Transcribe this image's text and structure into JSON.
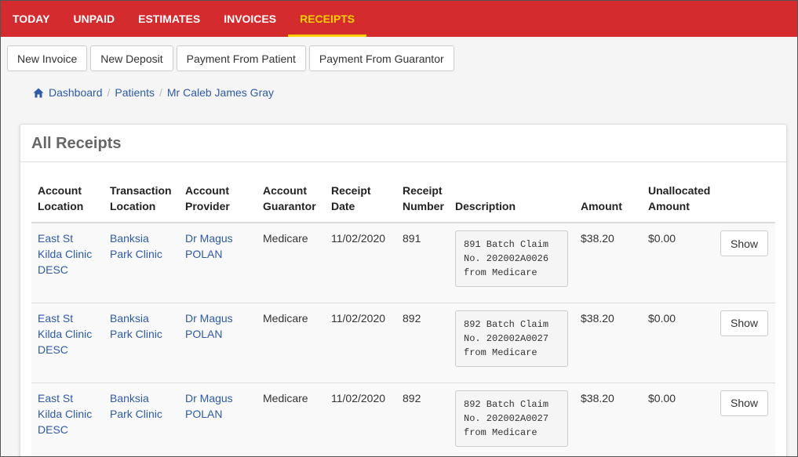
{
  "topnav": {
    "tabs": [
      {
        "label": "TODAY"
      },
      {
        "label": "UNPAID"
      },
      {
        "label": "ESTIMATES"
      },
      {
        "label": "INVOICES"
      },
      {
        "label": "RECEIPTS"
      }
    ],
    "active": "RECEIPTS"
  },
  "actions": {
    "new_invoice": "New Invoice",
    "new_deposit": "New Deposit",
    "payment_from_patient": "Payment From Patient",
    "payment_from_guarantor": "Payment From Guarantor"
  },
  "breadcrumb": {
    "dashboard": "Dashboard",
    "patients": "Patients",
    "patient_name": "Mr Caleb James Gray"
  },
  "panel": {
    "title": "All Receipts"
  },
  "table": {
    "headers": {
      "account_location": "Account Location",
      "transaction_location": "Transaction Location",
      "account_provider": "Account Provider",
      "account_guarantor": "Account Guarantor",
      "receipt_date": "Receipt Date",
      "receipt_number": "Receipt Number",
      "description": "Description",
      "amount": "Amount",
      "unallocated_amount": "Unallocated Amount"
    },
    "rows": [
      {
        "account_location": "East St Kilda Clinic DESC",
        "transaction_location": "Banksia Park Clinic",
        "account_provider": "Dr Magus POLAN",
        "account_guarantor": "Medicare",
        "receipt_date": "11/02/2020",
        "receipt_number": "891",
        "description": "891 Batch Claim\nNo. 202002A0026\nfrom Medicare",
        "amount": "$38.20",
        "unallocated_amount": "$0.00",
        "action": "Show"
      },
      {
        "account_location": "East St Kilda Clinic DESC",
        "transaction_location": "Banksia Park Clinic",
        "account_provider": "Dr Magus POLAN",
        "account_guarantor": "Medicare",
        "receipt_date": "11/02/2020",
        "receipt_number": "892",
        "description": "892 Batch Claim\nNo. 202002A0027\nfrom Medicare",
        "amount": "$38.20",
        "unallocated_amount": "$0.00",
        "action": "Show"
      },
      {
        "account_location": "East St Kilda Clinic DESC",
        "transaction_location": "Banksia Park Clinic",
        "account_provider": "Dr Magus POLAN",
        "account_guarantor": "Medicare",
        "receipt_date": "11/02/2020",
        "receipt_number": "892",
        "description": "892 Batch Claim\nNo. 202002A0027\nfrom Medicare",
        "amount": "$38.20",
        "unallocated_amount": "$0.00",
        "action": "Show"
      }
    ]
  },
  "colors": {
    "nav_background": "#d42b2e",
    "nav_active": "#ffd100",
    "link": "#2e5aa8"
  },
  "icons": {
    "breadcrumb_home": "home-icon"
  }
}
